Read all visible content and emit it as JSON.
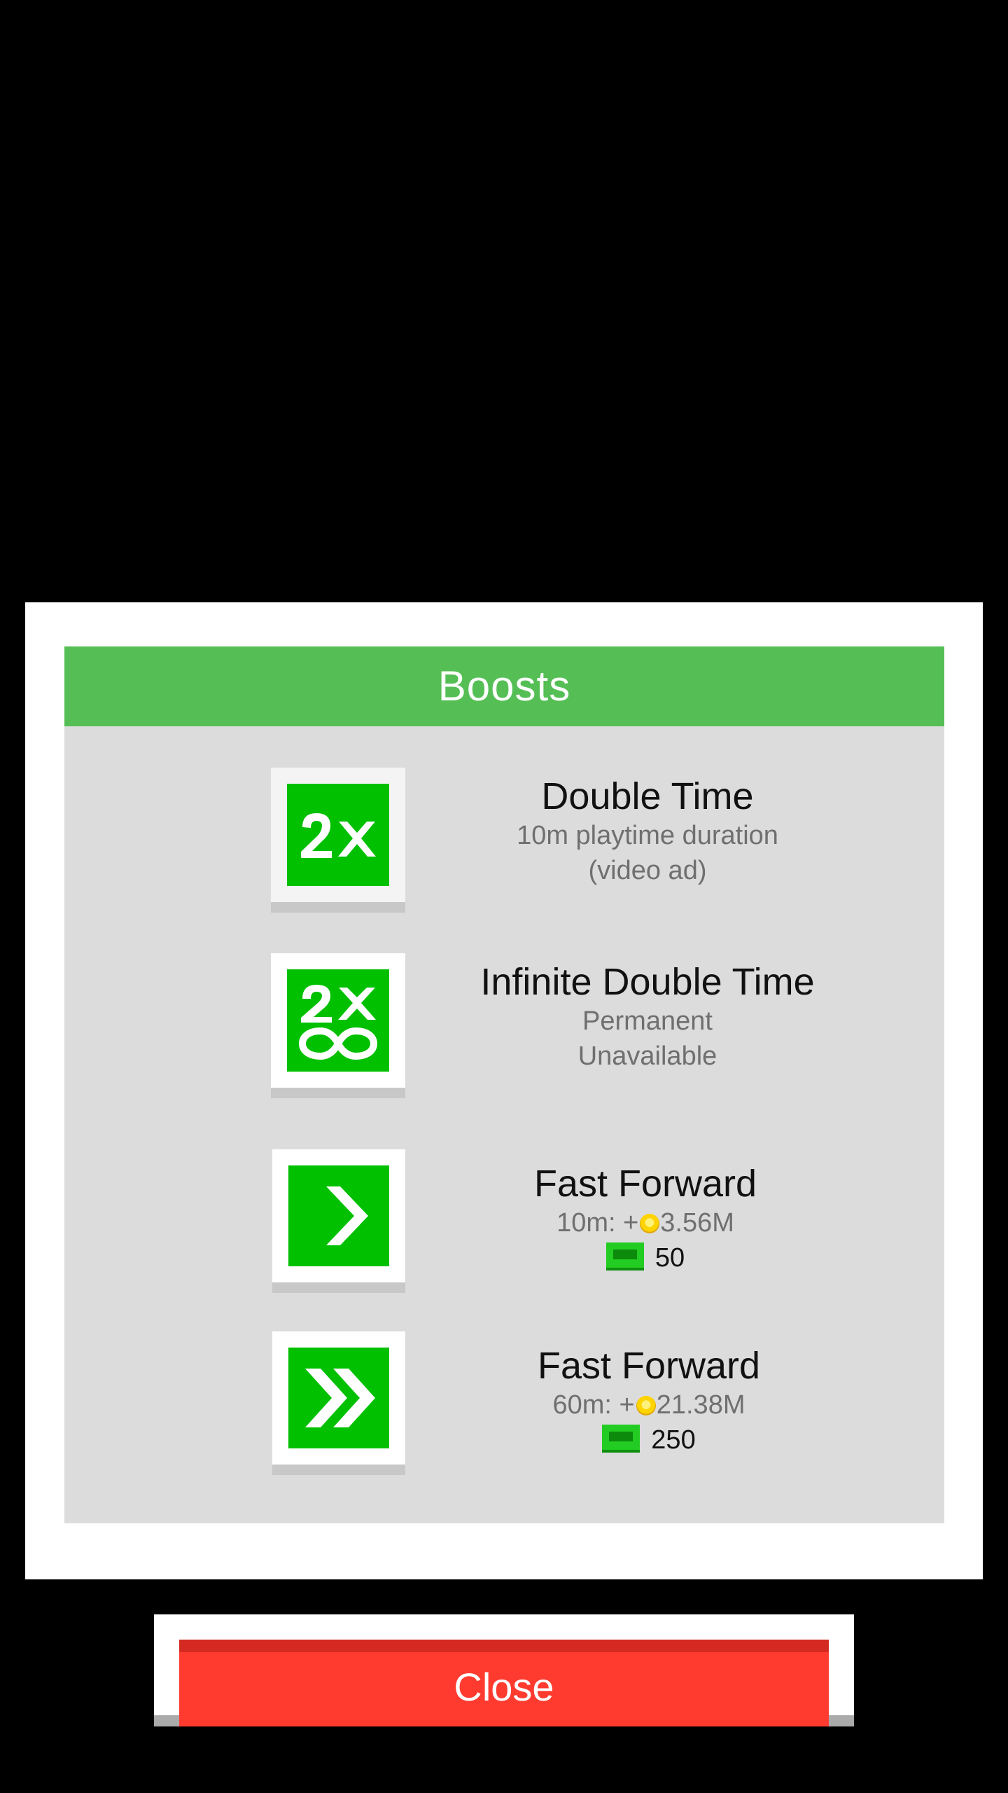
{
  "dialog": {
    "title": "Boosts",
    "colors": {
      "header": "#55bf55",
      "icon": "#00c000",
      "close": "#ff3b30"
    },
    "boosts": [
      {
        "icon": "double-time-2x-icon",
        "title": "Double Time",
        "line1": "10m playtime duration",
        "line2": "(video ad)"
      },
      {
        "icon": "infinite-double-time-icon",
        "title": "Infinite Double Time",
        "line1": "Permanent",
        "line2": "Unavailable"
      },
      {
        "icon": "fast-forward-single-chevron-icon",
        "title": "Fast Forward",
        "duration": "10m: +",
        "coins": "3.56M",
        "cost": "50"
      },
      {
        "icon": "fast-forward-double-chevron-icon",
        "title": "Fast Forward",
        "duration": "60m: +",
        "coins": "21.38M",
        "cost": "250"
      }
    ]
  },
  "footer": {
    "close_label": "Close"
  }
}
